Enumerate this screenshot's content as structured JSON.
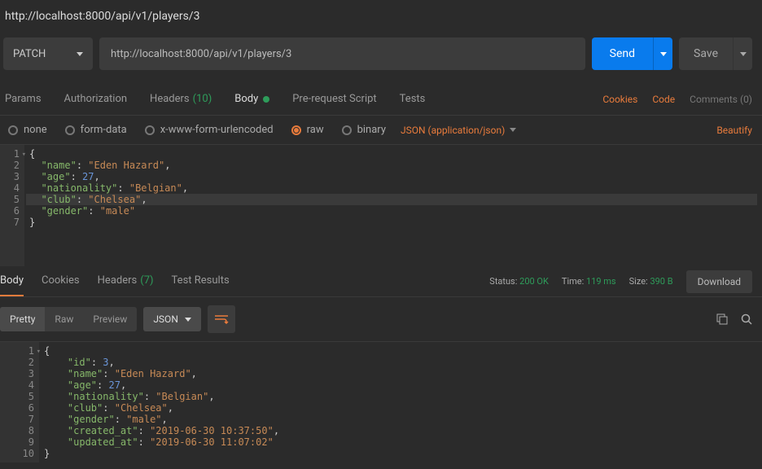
{
  "url_display": "http://localhost:8000/api/v1/players/3",
  "request": {
    "method": "PATCH",
    "url": "http://localhost:8000/api/v1/players/3",
    "send": "Send",
    "save": "Save"
  },
  "req_tabs": {
    "params": "Params",
    "auth": "Authorization",
    "headers": "Headers",
    "headers_count": "(10)",
    "body": "Body",
    "prereq": "Pre-request Script",
    "tests": "Tests",
    "cookies": "Cookies",
    "code": "Code",
    "comments": "Comments (0)"
  },
  "body_types": {
    "none": "none",
    "formdata": "form-data",
    "xwww": "x-www-form-urlencoded",
    "raw": "raw",
    "binary": "binary",
    "content_type": "JSON (application/json)",
    "beautify": "Beautify"
  },
  "req_body": {
    "lines": [
      "1",
      "2",
      "3",
      "4",
      "5",
      "6",
      "7"
    ],
    "payload": {
      "name": "Eden Hazard",
      "age": 27,
      "nationality": "Belgian",
      "club": "Chelsea",
      "gender": "male"
    }
  },
  "resp_tabs": {
    "body": "Body",
    "cookies": "Cookies",
    "headers": "Headers",
    "headers_count": "(7)",
    "tests": "Test Results"
  },
  "resp_meta": {
    "status_label": "Status:",
    "status": "200 OK",
    "time_label": "Time:",
    "time": "119 ms",
    "size_label": "Size:",
    "size": "390 B",
    "download": "Download"
  },
  "resp_toolbar": {
    "pretty": "Pretty",
    "raw": "Raw",
    "preview": "Preview",
    "format": "JSON"
  },
  "resp_body": {
    "lines": [
      "1",
      "2",
      "3",
      "4",
      "5",
      "6",
      "7",
      "8",
      "9",
      "10"
    ],
    "payload": {
      "id": 3,
      "name": "Eden Hazard",
      "age": 27,
      "nationality": "Belgian",
      "club": "Chelsea",
      "gender": "male",
      "created_at": "2019-06-30 10:37:50",
      "updated_at": "2019-06-30 11:07:02"
    }
  }
}
